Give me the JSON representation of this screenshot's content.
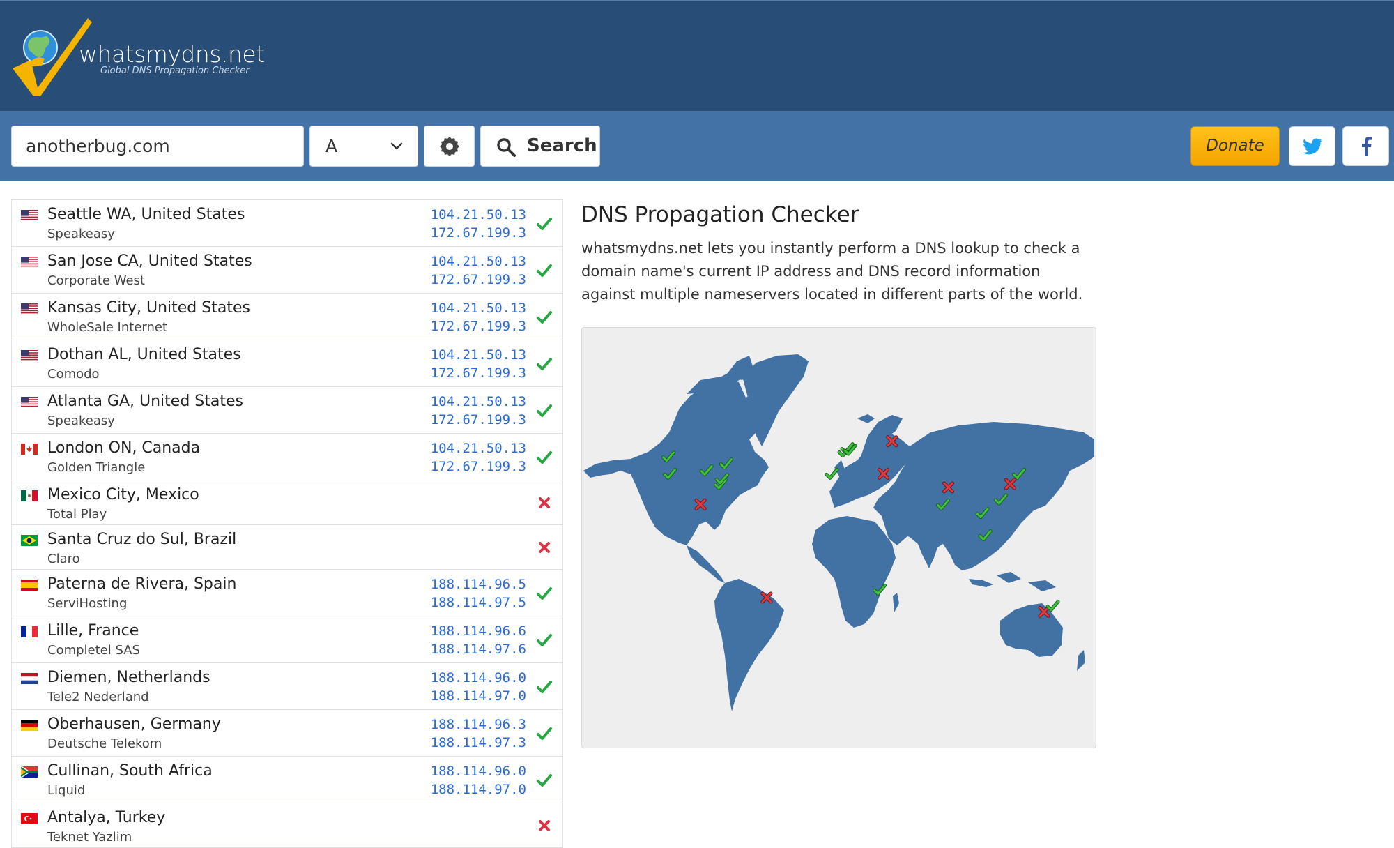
{
  "header": {
    "brand": "whatsmydns.net",
    "tagline": "Global DNS Propagation Checker"
  },
  "search": {
    "domain": "anotherbug.com",
    "record_type": "A",
    "button_label": "Search",
    "donate_label": "Donate"
  },
  "results": [
    {
      "location": "Seattle WA, United States",
      "provider": "Speakeasy",
      "flag": "us-flag-icon",
      "ips": [
        "104.21.50.13",
        "172.67.199.3"
      ],
      "status": "ok"
    },
    {
      "location": "San Jose CA, United States",
      "provider": "Corporate West",
      "flag": "us-flag-icon",
      "ips": [
        "104.21.50.13",
        "172.67.199.3"
      ],
      "status": "ok"
    },
    {
      "location": "Kansas City, United States",
      "provider": "WholeSale Internet",
      "flag": "us-flag-icon",
      "ips": [
        "104.21.50.13",
        "172.67.199.3"
      ],
      "status": "ok"
    },
    {
      "location": "Dothan AL, United States",
      "provider": "Comodo",
      "flag": "us-flag-icon",
      "ips": [
        "104.21.50.13",
        "172.67.199.3"
      ],
      "status": "ok"
    },
    {
      "location": "Atlanta GA, United States",
      "provider": "Speakeasy",
      "flag": "us-flag-icon",
      "ips": [
        "104.21.50.13",
        "172.67.199.3"
      ],
      "status": "ok"
    },
    {
      "location": "London ON, Canada",
      "provider": "Golden Triangle",
      "flag": "ca-flag-icon",
      "ips": [
        "104.21.50.13",
        "172.67.199.3"
      ],
      "status": "ok"
    },
    {
      "location": "Mexico City, Mexico",
      "provider": "Total Play",
      "flag": "mx-flag-icon",
      "ips": [],
      "status": "fail"
    },
    {
      "location": "Santa Cruz do Sul, Brazil",
      "provider": "Claro",
      "flag": "br-flag-icon",
      "ips": [],
      "status": "fail"
    },
    {
      "location": "Paterna de Rivera, Spain",
      "provider": "ServiHosting",
      "flag": "es-flag-icon",
      "ips": [
        "188.114.96.5",
        "188.114.97.5"
      ],
      "status": "ok"
    },
    {
      "location": "Lille, France",
      "provider": "Completel SAS",
      "flag": "fr-flag-icon",
      "ips": [
        "188.114.96.6",
        "188.114.97.6"
      ],
      "status": "ok"
    },
    {
      "location": "Diemen, Netherlands",
      "provider": "Tele2 Nederland",
      "flag": "nl-flag-icon",
      "ips": [
        "188.114.96.0",
        "188.114.97.0"
      ],
      "status": "ok"
    },
    {
      "location": "Oberhausen, Germany",
      "provider": "Deutsche Telekom",
      "flag": "de-flag-icon",
      "ips": [
        "188.114.96.3",
        "188.114.97.3"
      ],
      "status": "ok"
    },
    {
      "location": "Cullinan, South Africa",
      "provider": "Liquid",
      "flag": "za-flag-icon",
      "ips": [
        "188.114.96.0",
        "188.114.97.0"
      ],
      "status": "ok"
    },
    {
      "location": "Antalya, Turkey",
      "provider": "Teknet Yazlim",
      "flag": "tr-flag-icon",
      "ips": [],
      "status": "fail"
    }
  ],
  "info": {
    "title": "DNS Propagation Checker",
    "text": "whatsmydns.net lets you instantly perform a DNS lookup to check a domain name's current IP address and DNS record information against multiple nameservers located in different parts of the world."
  },
  "map": {
    "land_color": "#4271a4",
    "ok_color": "#3cc23c",
    "fail_color": "#e0383f",
    "markers": [
      {
        "status": "ok",
        "lon": -122,
        "lat": 47
      },
      {
        "status": "ok",
        "lon": -121,
        "lat": 37
      },
      {
        "status": "ok",
        "lon": -95,
        "lat": 39
      },
      {
        "status": "ok",
        "lon": -85,
        "lat": 31
      },
      {
        "status": "ok",
        "lon": -84,
        "lat": 34
      },
      {
        "status": "ok",
        "lon": -81,
        "lat": 43
      },
      {
        "status": "fail",
        "lon": -99,
        "lat": 19
      },
      {
        "status": "fail",
        "lon": -52,
        "lat": -30
      },
      {
        "status": "ok",
        "lon": -6,
        "lat": 37
      },
      {
        "status": "ok",
        "lon": 3,
        "lat": 50
      },
      {
        "status": "ok",
        "lon": 5,
        "lat": 52
      },
      {
        "status": "ok",
        "lon": 7,
        "lat": 51
      },
      {
        "status": "ok",
        "lon": 28,
        "lat": -26
      },
      {
        "status": "fail",
        "lon": 31,
        "lat": 37
      },
      {
        "status": "fail",
        "lon": 37,
        "lat": 56
      },
      {
        "status": "fail",
        "lon": 77,
        "lat": 29
      },
      {
        "status": "ok",
        "lon": 73,
        "lat": 19
      },
      {
        "status": "ok",
        "lon": 101,
        "lat": 14
      },
      {
        "status": "ok",
        "lon": 103,
        "lat": 1
      },
      {
        "status": "ok",
        "lon": 114,
        "lat": 22
      },
      {
        "status": "fail",
        "lon": 121,
        "lat": 31
      },
      {
        "status": "ok",
        "lon": 127,
        "lat": 37
      },
      {
        "status": "fail",
        "lon": 145,
        "lat": -37
      },
      {
        "status": "ok",
        "lon": 151,
        "lat": -34
      }
    ]
  }
}
